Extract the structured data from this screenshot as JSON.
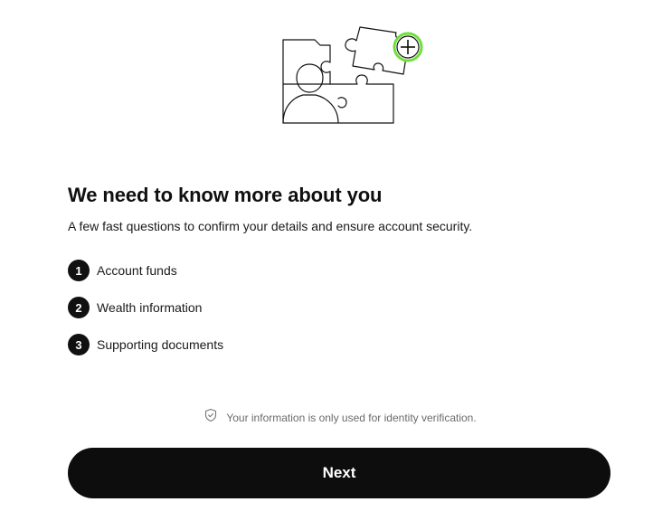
{
  "header": {
    "illustration_icon": "puzzle-person-plus-icon",
    "accent_color": "#6fe03a"
  },
  "main": {
    "title": "We need to know more about you",
    "subtitle": "A few fast questions to confirm your details and ensure account security.",
    "steps": [
      {
        "number": "1",
        "label": "Account funds"
      },
      {
        "number": "2",
        "label": "Wealth information"
      },
      {
        "number": "3",
        "label": "Supporting documents"
      }
    ]
  },
  "footer": {
    "notice_icon": "shield-check-icon",
    "notice": "Your information is only used for identity verification.",
    "next_label": "Next"
  }
}
